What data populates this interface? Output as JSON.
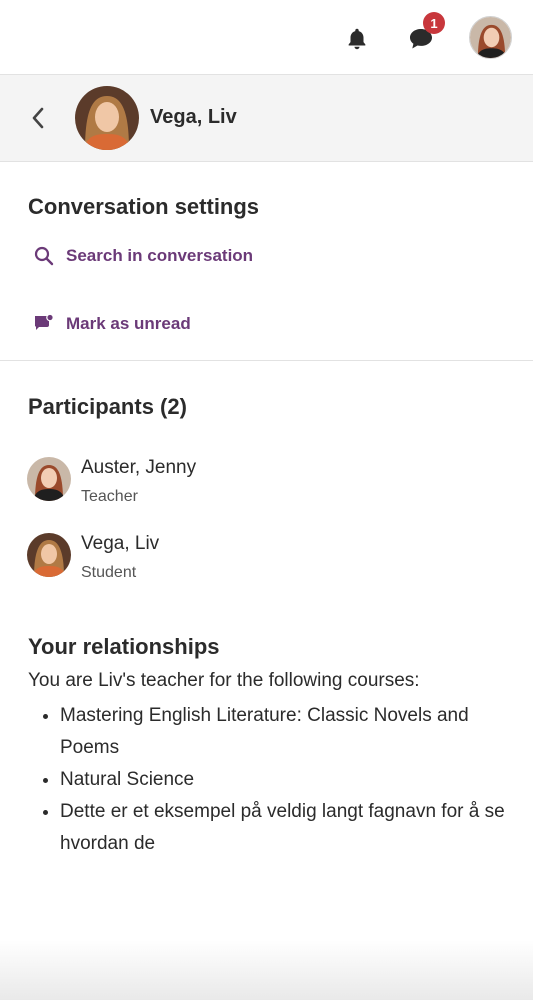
{
  "topbar": {
    "notifications_icon": "bell-icon",
    "messages_icon": "chat-icon",
    "messages_badge": "1",
    "user_avatar": "avatar"
  },
  "header": {
    "back_icon": "chevron-left-icon",
    "name": "Vega, Liv"
  },
  "settings": {
    "title": "Conversation settings",
    "search_label": "Search in conversation",
    "unread_label": "Mark as unread",
    "accent_color": "#6b3a78"
  },
  "participants": {
    "title": "Participants (2)",
    "items": [
      {
        "name": "Auster, Jenny",
        "role": "Teacher"
      },
      {
        "name": "Vega, Liv",
        "role": "Student"
      }
    ]
  },
  "relationships": {
    "title": "Your relationships",
    "intro": "You are Liv's teacher for the following courses:",
    "courses": [
      "Mastering English Literature: Classic Novels and Poems",
      "Natural Science",
      "Dette er et eksempel på veldig langt fagnavn for å se hvordan de"
    ]
  }
}
